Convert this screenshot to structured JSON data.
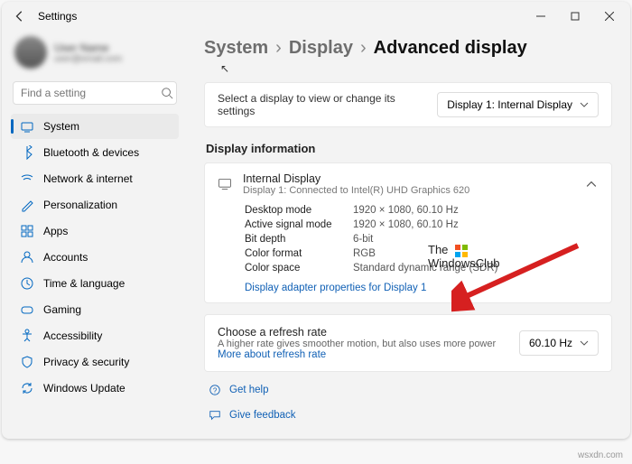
{
  "window": {
    "title": "Settings"
  },
  "search": {
    "placeholder": "Find a setting"
  },
  "nav": {
    "items": [
      {
        "label": "System",
        "icon": "system"
      },
      {
        "label": "Bluetooth & devices",
        "icon": "bluetooth"
      },
      {
        "label": "Network & internet",
        "icon": "wifi"
      },
      {
        "label": "Personalization",
        "icon": "personalize"
      },
      {
        "label": "Apps",
        "icon": "apps"
      },
      {
        "label": "Accounts",
        "icon": "accounts"
      },
      {
        "label": "Time & language",
        "icon": "time"
      },
      {
        "label": "Gaming",
        "icon": "gaming"
      },
      {
        "label": "Accessibility",
        "icon": "accessibility"
      },
      {
        "label": "Privacy & security",
        "icon": "privacy"
      },
      {
        "label": "Windows Update",
        "icon": "update"
      }
    ]
  },
  "breadcrumbs": {
    "a": "System",
    "b": "Display",
    "c": "Advanced display"
  },
  "selectcard": {
    "text": "Select a display to view or change its settings",
    "dropdown": "Display 1: Internal Display"
  },
  "info_section_title": "Display information",
  "info": {
    "title": "Internal Display",
    "sub": "Display 1: Connected to Intel(R) UHD Graphics 620",
    "rows": [
      {
        "k": "Desktop mode",
        "v": "1920 × 1080, 60.10 Hz"
      },
      {
        "k": "Active signal mode",
        "v": "1920 × 1080, 60.10 Hz"
      },
      {
        "k": "Bit depth",
        "v": "6-bit"
      },
      {
        "k": "Color format",
        "v": "RGB"
      },
      {
        "k": "Color space",
        "v": "Standard dynamic range (SDR)"
      }
    ],
    "link": "Display adapter properties for Display 1"
  },
  "refresh": {
    "title": "Choose a refresh rate",
    "sub_a": "A higher rate gives smoother motion, but also uses more power ",
    "sub_link": "More about refresh rate",
    "dropdown": "60.10 Hz"
  },
  "help": {
    "get": "Get help",
    "feedback": "Give feedback"
  },
  "brand": {
    "a": "The",
    "b": "WindowsClub"
  },
  "watermark": "wsxdn.com"
}
